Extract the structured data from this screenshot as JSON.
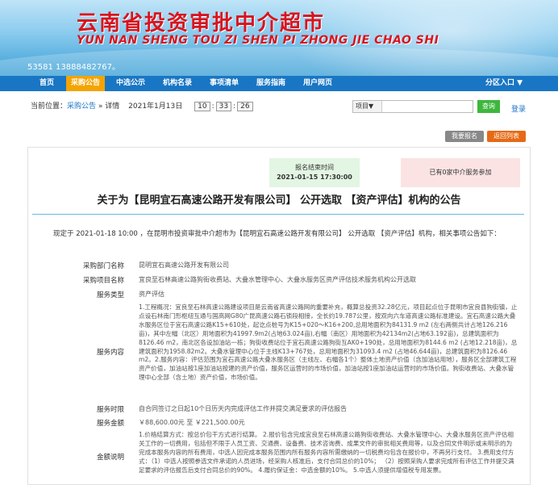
{
  "header": {
    "title_cn": "云南省投资审批中介超市",
    "title_en": "YUN NAN SHENG TOU ZI SHEN PI ZHONG JIE CHAO SHI",
    "phone": "53581 13888482767。"
  },
  "nav": {
    "items": [
      "首页",
      "采购公告",
      "中选公示",
      "机构名录",
      "事项清单",
      "服务指南",
      "用户网页"
    ],
    "active": "采购公告",
    "region": "分区入口 ▼"
  },
  "breadcrumb": {
    "prefix": "当前位置：",
    "link": "采购公告",
    "sep": " » 详情",
    "date": "2021年1月13日",
    "hh": "10",
    "mm": "33",
    "ss": "26"
  },
  "search": {
    "select": "项目▼",
    "button": "查询",
    "login": "登录"
  },
  "actions": {
    "report": "我要报名",
    "back": "返回列表"
  },
  "deadline": {
    "label": "报名结束时间",
    "time": "2021-01-15 17:30:00"
  },
  "participants": "已有0家中介服务参加",
  "announcement": {
    "title": "关于为【昆明宜石高速公路开发有限公司】 公开选取 【资产评估】机构的公告",
    "intro": "现定于 2021-01-18 10:00 ，在昆明市投资审批中介超市为【昆明宜石高速公路开发有限公司】 公开选取 【资产评估】机构，相关事项公告如下："
  },
  "details": [
    {
      "key": "采购部门名称",
      "value": "昆明宜石高速公路开发有限公司"
    },
    {
      "key": "采购项目名称",
      "value": "宜良至石林高速公路狗街收费站、大叠水管理中心、大叠水服务区资产评估技术服务机构公开选取"
    },
    {
      "key": "服务类型",
      "value": "资产评估"
    },
    {
      "key": "服务内容",
      "value": "1.工程概况：宜良至石林高速公路建设项目是云南省高速公路网的重要补充，概算总投资32.28亿元，项目起点位于昆明市宜良县狗街镇，止点设石林南门形枢纽互通与国高网G80广昆高速公路石锁段相接，全长约19.787公里，按双向六车道高速公路标准建设。宜石高速公路大叠水服务区位于宜石高速公路K15+610处，起讫点桩号为K15+020～K16+200,总用地面积为84131.9 m2 (左右两侧共计占地126.216亩)，其中左幅（北区）用地面积为41997.9m2(占地63.024亩),右幅（南区）用地面积为42134m2(占地63.192亩)，总建筑面积为8126.46 m2，南北区各设加油站一栋；狗街收费站位于宜石高速公路狗街互AK0+190处，总用地面积为8144.6 m2 (占地12.218亩)，总建筑面积为1958.82m2。大叠水管理中心位于主线K13+767处，总用地面积为31093.4 m2 (占地46.644亩)，总建筑面积为8126.46 m2。2.服务内容：评估范围为宜石高速公路大叠水服务区（主线左、右幅各1个）整体土地资产价值（含加油站用地），服务区全部建筑工程资产价值，加油站按1座加油站按建的资产价值，服务区运营时的市场价值，加油站按1座加油站运营时的市场价值。狗街收费站、大叠水管理中心全部（含土地）资产价值，市场价值。"
    },
    {
      "key": "服务时限",
      "value": "自合同签订之日起10个日历天内完成评估工作并提交满足要求的评估报告"
    },
    {
      "key": "服务金额",
      "value": "￥88,600.00元 至 ￥221,500.00元"
    },
    {
      "key": "金额说明",
      "value": "1.价格结算方式：按总价包干方式进行结算。 2.报价包含完成宜良至石林高速公路狗街收费站、大叠水管理中心、大叠水服务区资产评估相关工作的一切费用，包括但不限于人员工资、交通费、设备费、技术咨询费、成果文件的审批相关费用等，以及合同文件明示或未明示的为完成本服务内容的所有费用，中选人因完成本服务范围内所有服务内容所需缴纳的一切税费均包含在报价中，不再另行支付。 3.费用支付方式：（1）中选人按照参选文件承诺的人员进场，经采购人核准后，支付合同总价的10%； （2）按照采购人要求完成所有评估工作并提交满足要求的评估报告后支付合同总价的90%。 4.履约保证金：中选金额的10%。 5.中选人须提供增值税专用发票。"
    }
  ]
}
